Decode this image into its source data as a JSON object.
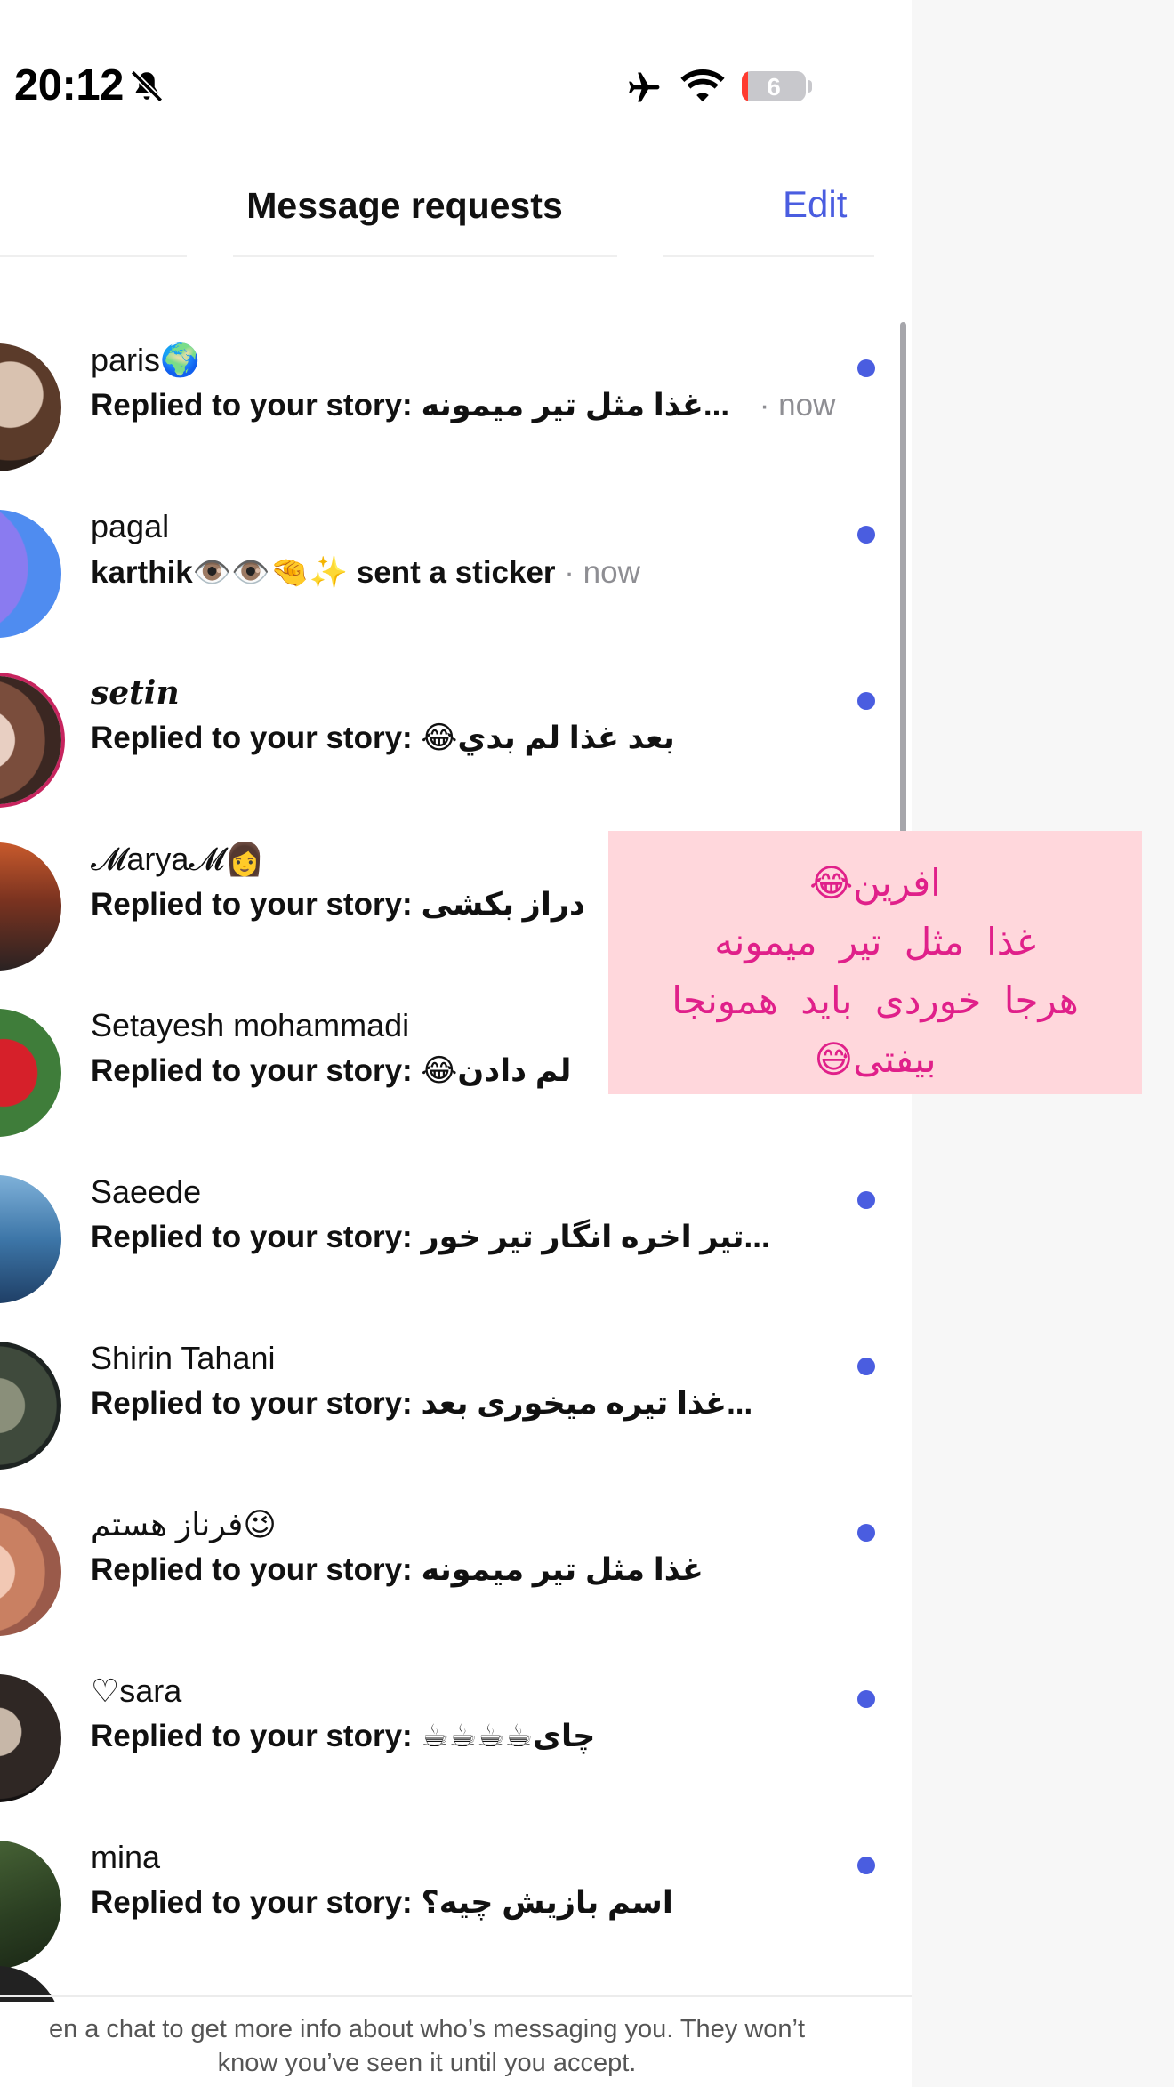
{
  "status_bar": {
    "time": "20:12",
    "battery_level": "6",
    "icons": [
      "bell-slash-icon",
      "airplane-icon",
      "wifi-icon",
      "battery-icon"
    ]
  },
  "header": {
    "title": "Message requests",
    "edit_label": "Edit"
  },
  "accent_color": "#4a5de0",
  "requests": [
    {
      "name": "paris🌍",
      "preview": "Replied to your story: غذا مثل تیر میمونه...",
      "time": " · now",
      "unread": true
    },
    {
      "name": "pagal",
      "preview": "karthik👁️👁️🤏✨ sent a sticker",
      "time": " · now",
      "unread": true
    },
    {
      "name": "setin",
      "preview": "Replied to your story: 😂بعد غذا لم بدي",
      "time": "",
      "unread": true
    },
    {
      "name": "𝓜arya𝓜👩",
      "preview": "Replied to your story: دراز بکشی",
      "time": "",
      "unread": false
    },
    {
      "name": "Setayesh mohammadi",
      "preview": "Replied to your story: 😂لم دادن",
      "time": "",
      "unread": false
    },
    {
      "name": "Saeede",
      "preview": "Replied to your story: تیر اخره انگار تیر خور...",
      "time": "",
      "unread": true
    },
    {
      "name": "Shirin Tahani",
      "preview": "Replied to your story: غذا تیره میخوری بعد...",
      "time": "",
      "unread": true
    },
    {
      "name": "فرناز هستم😉",
      "preview": "Replied to your story: غذا مثل تیر میمونه",
      "time": "",
      "unread": true
    },
    {
      "name": "♡sara",
      "preview": "Replied to your story: ☕☕☕☕چای",
      "time": "",
      "unread": true
    },
    {
      "name": "mina",
      "preview": "Replied to your story: اسم بازیش چیه؟",
      "time": "",
      "unread": true
    }
  ],
  "overlay": {
    "lines": [
      "افرین😂",
      "غذا مثل تیر میمونه",
      "هرجا خوردی باید همونجا",
      "بیفتی😅"
    ]
  },
  "footer": {
    "line1": "en a chat to get more info about who’s messaging you. They won’t",
    "line2": "know you’ve seen it until you accept."
  }
}
